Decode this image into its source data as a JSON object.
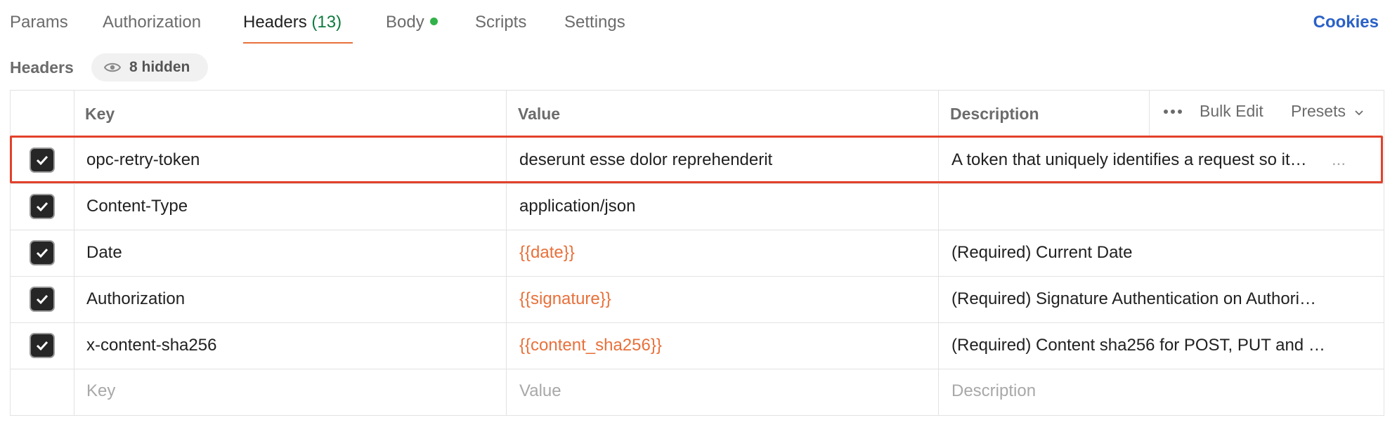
{
  "tabs": [
    {
      "label": "Params"
    },
    {
      "label": "Authorization"
    },
    {
      "label": "Headers",
      "count": "(13)"
    },
    {
      "label": "Body"
    },
    {
      "label": "Scripts"
    },
    {
      "label": "Settings"
    }
  ],
  "cookies_label": "Cookies",
  "section": {
    "title": "Headers",
    "hidden_label": "8 hidden"
  },
  "table": {
    "columns": {
      "key": "Key",
      "value": "Value",
      "description": "Description"
    },
    "actions": {
      "bulk_edit": "Bulk Edit",
      "presets": "Presets"
    },
    "rows": [
      {
        "checked": true,
        "key": "opc-retry-token",
        "value": "deserunt esse dolor reprehenderit",
        "description": "A token that uniquely identifies a request so it…"
      },
      {
        "checked": true,
        "key": "Content-Type",
        "value": "application/json",
        "description": ""
      },
      {
        "checked": true,
        "key": "Date",
        "value": "{{date}}",
        "description": "(Required) Current Date"
      },
      {
        "checked": true,
        "key": "Authorization",
        "value": "{{signature}}",
        "description": "(Required) Signature Authentication on Authori…"
      },
      {
        "checked": true,
        "key": "x-content-sha256",
        "value": "{{content_sha256}}",
        "description": "(Required) Content sha256 for POST, PUT and …"
      }
    ],
    "placeholders": {
      "key": "Key",
      "value": "Value",
      "description": "Description"
    },
    "row_more": "..."
  },
  "colors": {
    "accent": "#e8703a",
    "link": "#2a61c7",
    "highlight": "#e2412b",
    "success": "#32b24a",
    "count": "#0f7b3f"
  }
}
